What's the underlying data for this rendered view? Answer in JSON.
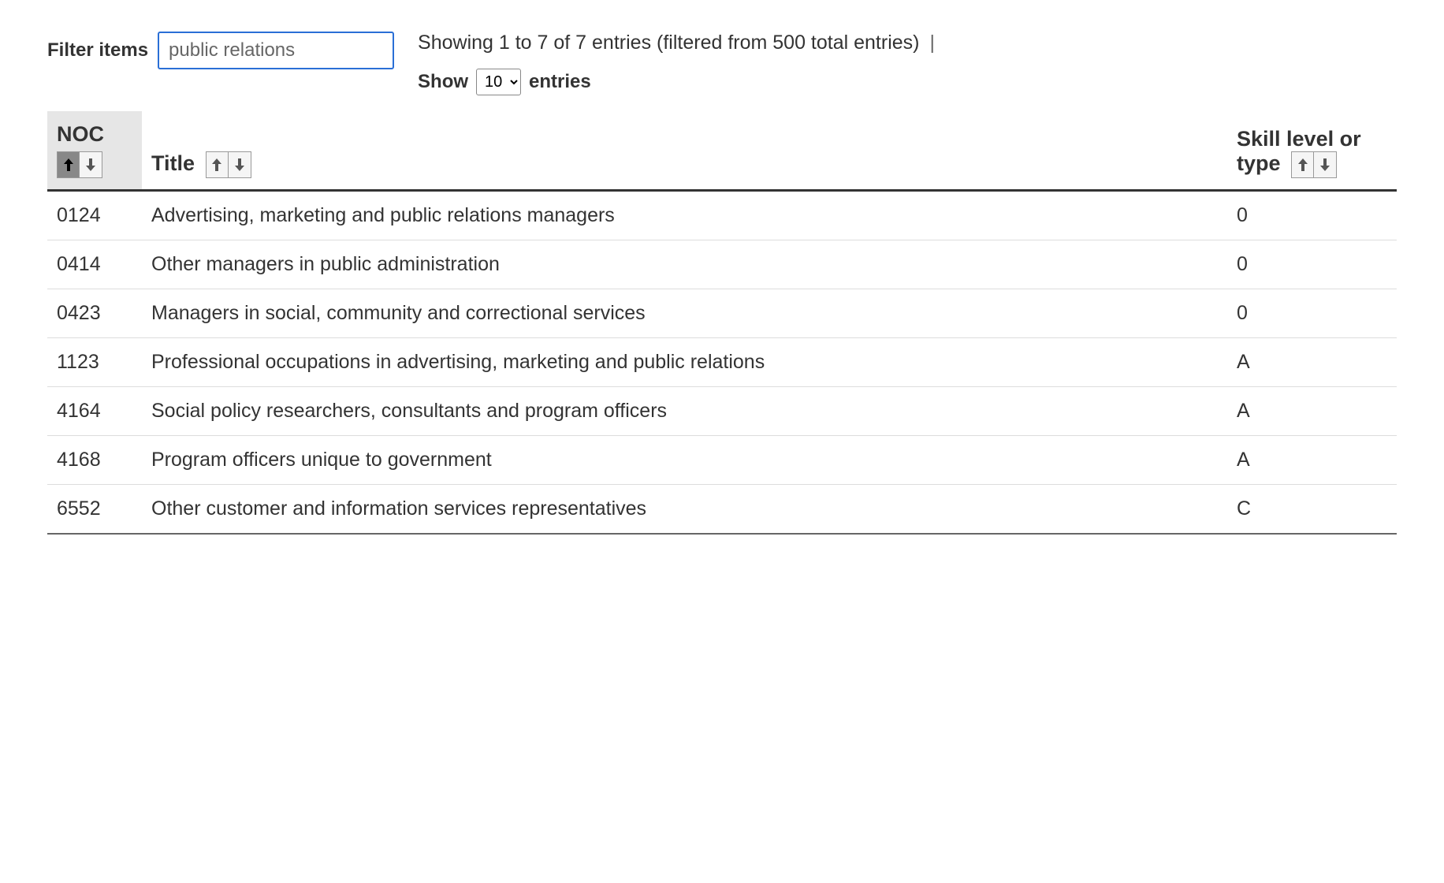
{
  "filter": {
    "label": "Filter items",
    "value": "public relations"
  },
  "showing_text": "Showing 1 to 7 of 7 entries (filtered from 500 total entries)",
  "show_entries": {
    "prefix": "Show",
    "suffix": "entries",
    "selected": "10"
  },
  "columns": {
    "noc": "NOC",
    "title": "Title",
    "skill": "Skill level or type"
  },
  "rows": [
    {
      "noc": "0124",
      "title": "Advertising, marketing and public relations managers",
      "skill": "0"
    },
    {
      "noc": "0414",
      "title": "Other managers in public administration",
      "skill": "0"
    },
    {
      "noc": "0423",
      "title": "Managers in social, community and correctional services",
      "skill": "0"
    },
    {
      "noc": "1123",
      "title": "Professional occupations in advertising, marketing and public relations",
      "skill": "A"
    },
    {
      "noc": "4164",
      "title": "Social policy researchers, consultants and program officers",
      "skill": "A"
    },
    {
      "noc": "4168",
      "title": "Program officers unique to government",
      "skill": "A"
    },
    {
      "noc": "6552",
      "title": "Other customer and information services representatives",
      "skill": "C"
    }
  ]
}
